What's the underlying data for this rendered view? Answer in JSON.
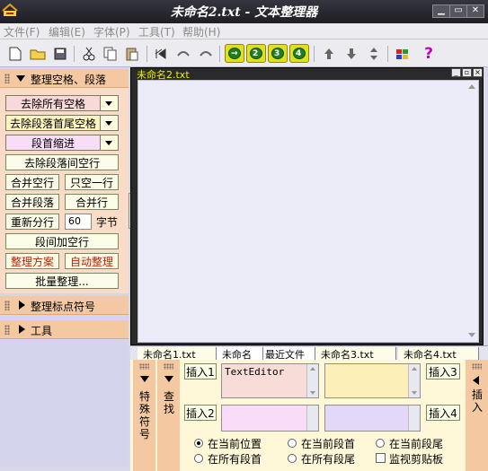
{
  "window": {
    "title": "未命名2.txt - 文本整理器"
  },
  "menu": [
    "文件(F)",
    "编辑(E)",
    "字体(P)",
    "工具(T)",
    "帮助(H)"
  ],
  "panel": {
    "section1_title": "整理空格、段落",
    "remove_all_spaces": "去除所有空格",
    "remove_leading_trailing": "去除段落首尾空格",
    "paragraph_indent": "段首缩进",
    "remove_blank_lines": "去除段落间空行",
    "merge_blank_lines": "合并空行",
    "keep_one_blank": "只空一行",
    "merge_paragraphs": "合并段落",
    "merge_lines": "合并行",
    "rewrap": "重新分行",
    "wrap_value": "60",
    "bytes_unit": "字节",
    "add_blank_lines": "段间加空行",
    "arrange_scheme": "整理方案",
    "auto_arrange": "自动整理",
    "batch_arrange": "批量整理...",
    "section2_title": "整理标点符号",
    "section3_title": "工具"
  },
  "editor": {
    "doc_title": "未命名2.txt"
  },
  "tabs": [
    "未命名1.txt",
    "未命名",
    "最近文件",
    "未命名3.txt",
    "未命名4.txt"
  ],
  "bottom": {
    "special_symbols": "特殊符号",
    "find": "查找",
    "insert_side": "插入",
    "insert1": "插入1",
    "insert2": "插入2",
    "insert3": "插入3",
    "insert4": "插入4",
    "text1": "TextEditor",
    "opt_cursor": "在当前位置",
    "opt_para_start": "在当前段首",
    "opt_para_end": "在当前段尾",
    "opt_all_start": "在所有段首",
    "opt_all_end": "在所有段尾",
    "opt_clipboard": "监视剪贴板"
  },
  "colors": {
    "accent": "#f4c8a0",
    "title_bg": "#2a2a32"
  }
}
